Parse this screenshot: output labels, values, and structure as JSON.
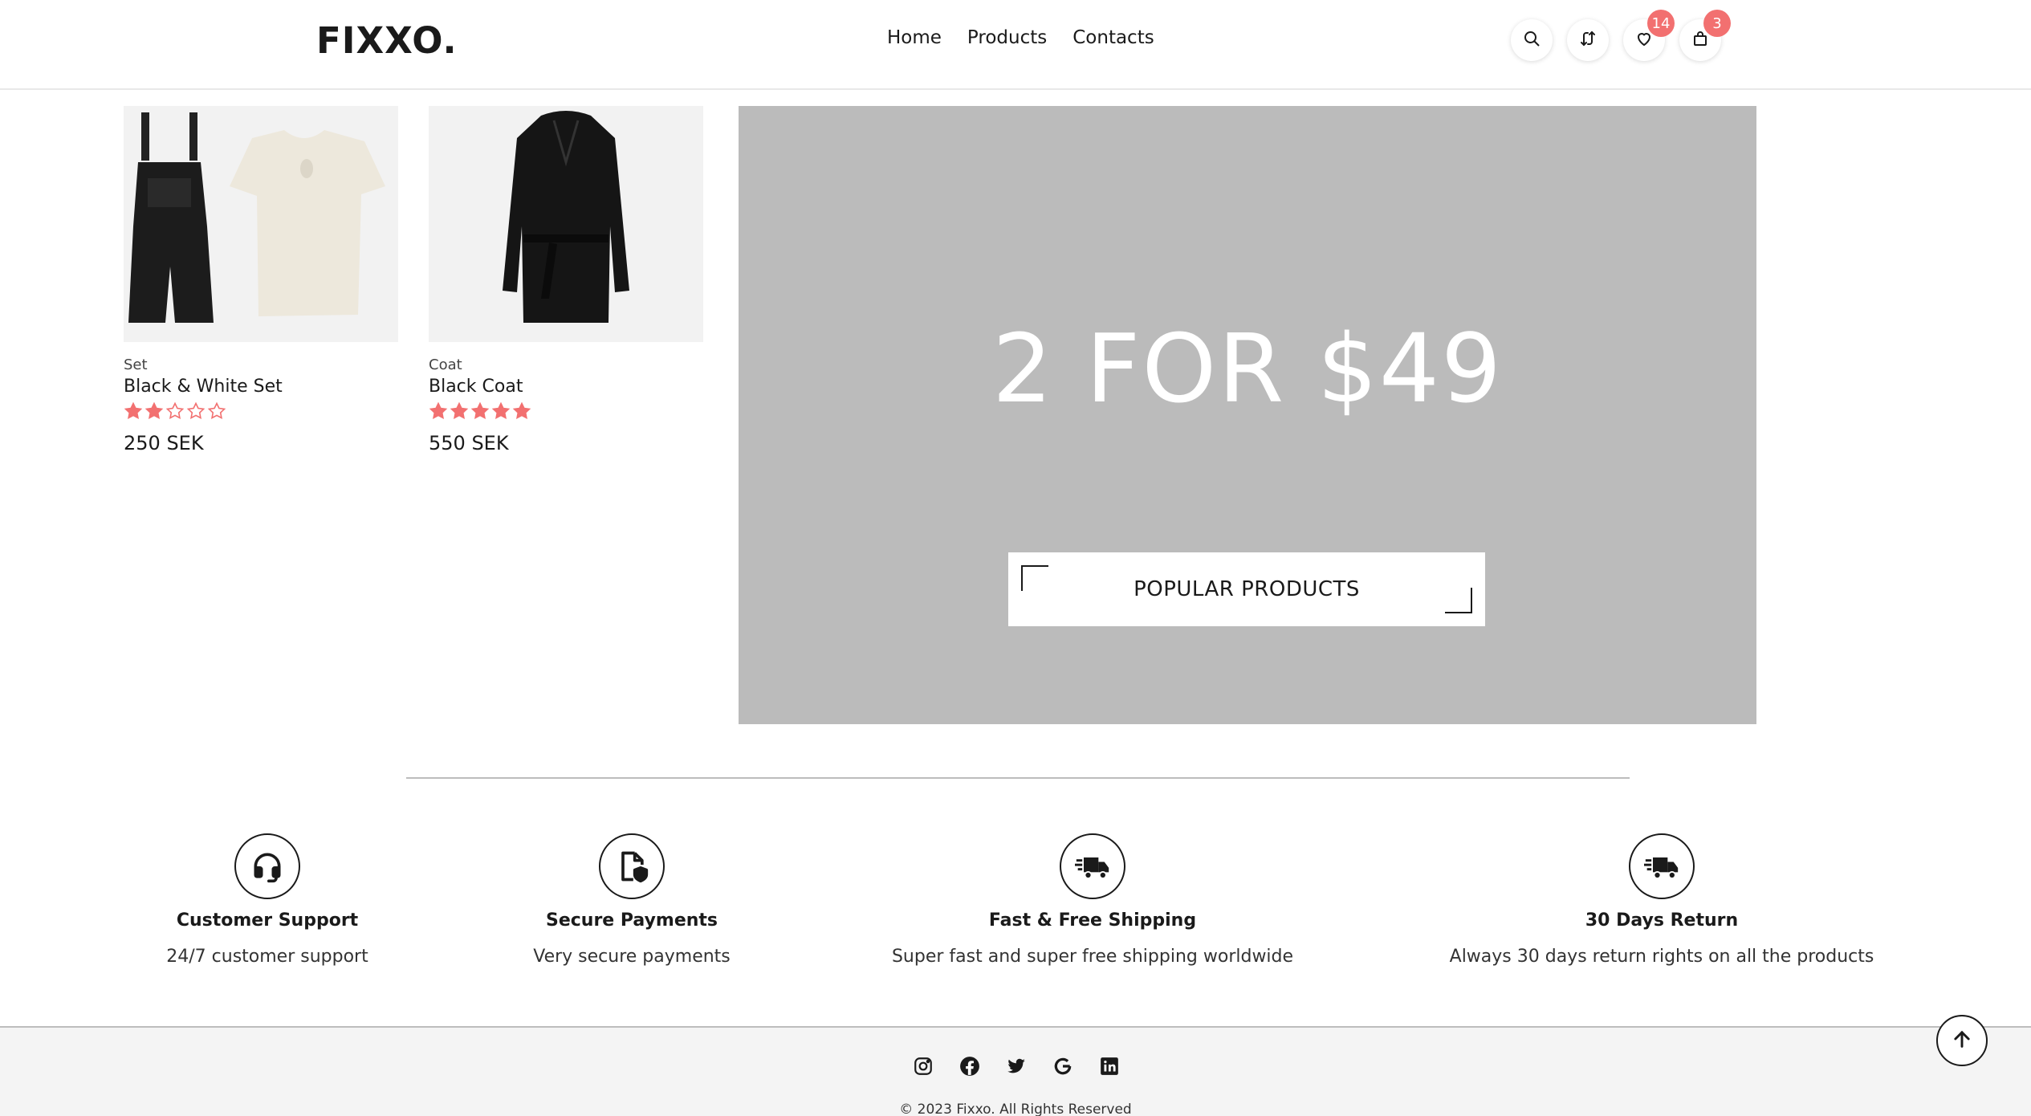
{
  "header": {
    "logo": "FIXXO.",
    "nav": [
      "Home",
      "Products",
      "Contacts"
    ],
    "icons": {
      "search": "search-icon",
      "compare": "compare-icon",
      "wishlist": "heart-icon",
      "cart": "bag-icon"
    },
    "wishlist_count": "14",
    "cart_count": "3"
  },
  "products": [
    {
      "category": "Set",
      "name": "Black & White Set",
      "rating": 2,
      "price": "250 SEK"
    },
    {
      "category": "Coat",
      "name": "Black Coat",
      "rating": 5,
      "price": "550 SEK"
    }
  ],
  "promo": {
    "title": "2 FOR $49",
    "button": "POPULAR PRODUCTS"
  },
  "features": [
    {
      "icon": "headset-icon",
      "title": "Customer Support",
      "desc": "24/7 customer support"
    },
    {
      "icon": "secure-document-icon",
      "title": "Secure Payments",
      "desc": "Very secure payments"
    },
    {
      "icon": "fast-truck-icon",
      "title": "Fast & Free Shipping",
      "desc": "Super fast and super free shipping worldwide"
    },
    {
      "icon": "return-truck-icon",
      "title": "30 Days Return",
      "desc": "Always 30 days return rights on all the products"
    }
  ],
  "footer": {
    "socials": [
      "instagram-icon",
      "facebook-icon",
      "twitter-icon",
      "google-icon",
      "linkedin-icon"
    ],
    "copyright": "© 2023 Fixxo. All Rights Reserved"
  },
  "colors": {
    "accent": "#f27070",
    "promo_bg": "#bbbbbb",
    "text": "#1a1a1a"
  }
}
